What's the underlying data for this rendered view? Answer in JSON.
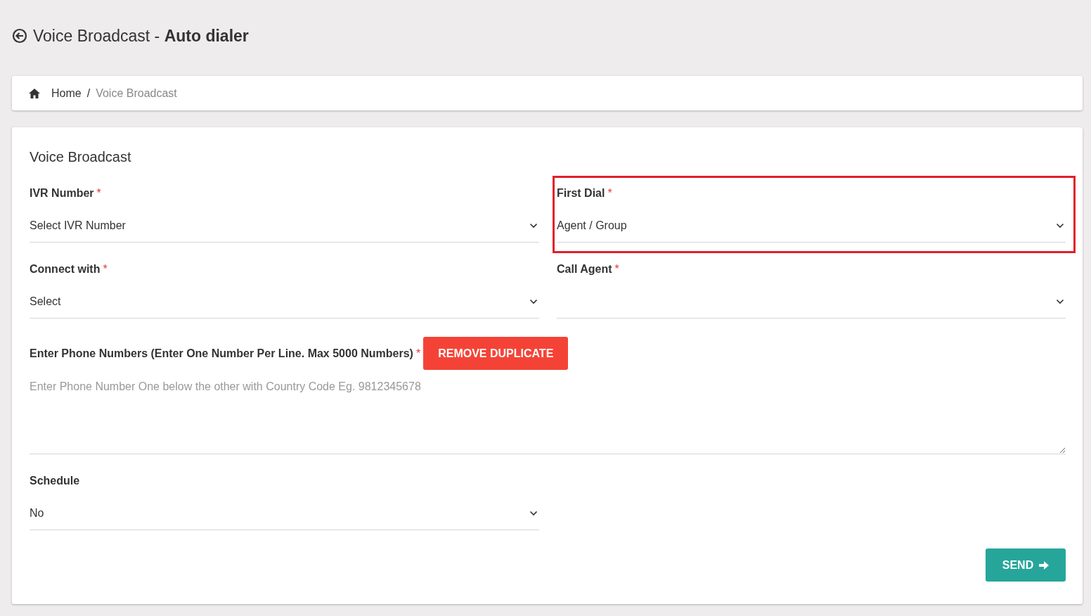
{
  "header": {
    "title": "Voice Broadcast - **Auto dialer**"
  },
  "breadcrumb": {
    "separator": "/",
    "items": [
      {
        "label": "Home",
        "kind": "home",
        "active": false
      },
      {
        "label": "Voice Broadcast",
        "kind": "page",
        "active": true
      }
    ]
  },
  "form": {
    "title": "Voice Broadcast",
    "required_mark": "*",
    "rows": [
      [
        {
          "label": "IVR Number",
          "required": true,
          "value": "Select IVR Number",
          "highlighted": false
        },
        {
          "label": "First Dial",
          "required": true,
          "value": "Agent / Group",
          "highlighted": true
        }
      ],
      [
        {
          "label": "Connect with",
          "required": true,
          "value": "Select",
          "highlighted": false
        },
        {
          "label": "Call Agent",
          "required": true,
          "highlighted": false
        }
      ]
    ],
    "phone": {
      "label": "Enter Phone Numbers (Enter One Number Per Line. Max 5000 Numbers)",
      "required": true,
      "button": "REMOVE DUPLICATE",
      "placeholder": "Enter Phone Number One below the other with Country Code Eg. 9812345678"
    },
    "schedule": {
      "label": "Schedule",
      "required": false,
      "value": "No",
      "highlighted": false
    },
    "submit": "SEND"
  }
}
